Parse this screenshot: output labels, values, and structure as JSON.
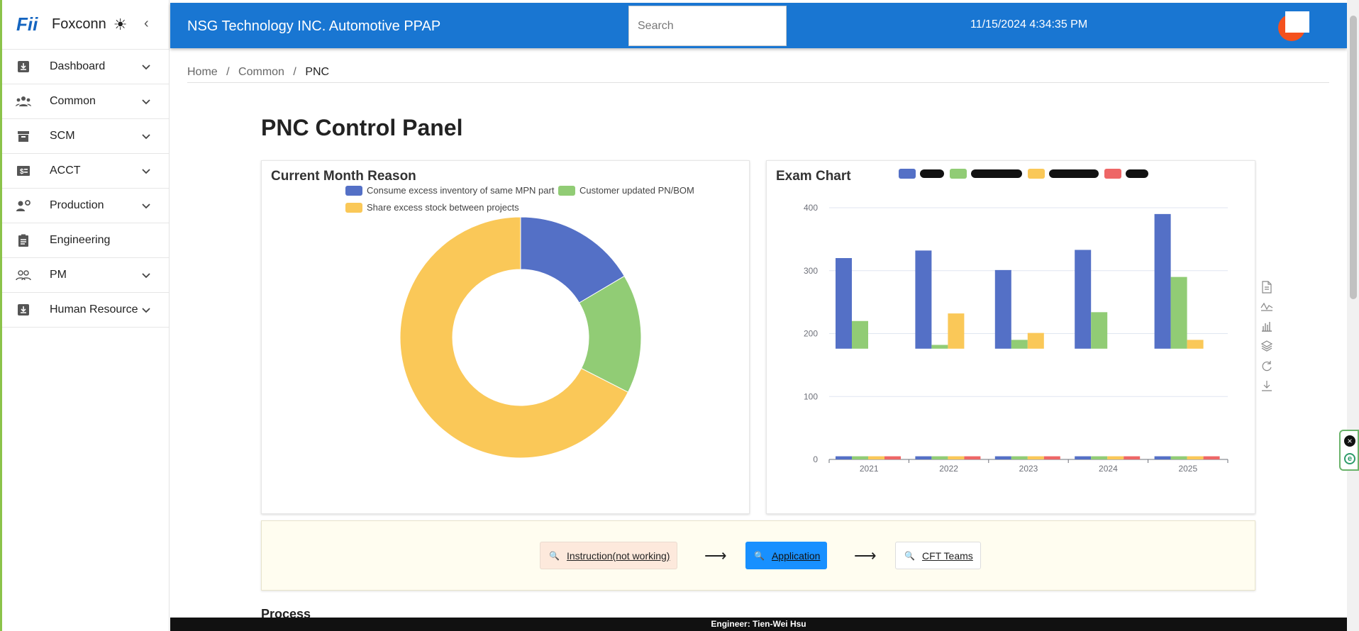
{
  "brand": {
    "logo": "Fii",
    "name": "Foxconn"
  },
  "sidebar": {
    "items": [
      {
        "label": "Dashboard",
        "icon": "download-box-icon",
        "expandable": true
      },
      {
        "label": "Common",
        "icon": "group-icon",
        "expandable": true
      },
      {
        "label": "SCM",
        "icon": "archive-icon",
        "expandable": true
      },
      {
        "label": "ACCT",
        "icon": "money-icon",
        "expandable": true
      },
      {
        "label": "Production",
        "icon": "worker-settings-icon",
        "expandable": true
      },
      {
        "label": "Engineering",
        "icon": "clipboard-icon",
        "expandable": false
      },
      {
        "label": "PM",
        "icon": "people-outline-icon",
        "expandable": true
      },
      {
        "label": "Human Resource",
        "icon": "download-box-icon",
        "expandable": true
      }
    ]
  },
  "header": {
    "title": "NSG Technology INC. Automotive PPAP",
    "search_placeholder": "Search",
    "datetime": "11/15/2024 4:34:35 PM",
    "color": "#1976d2"
  },
  "breadcrumb": [
    "Home",
    "Common",
    "PNC"
  ],
  "page": {
    "title": "PNC Control Panel"
  },
  "donut_card": {
    "title": "Current Month Reason",
    "legend": [
      "Consume excess inventory of same MPN part",
      "Customer updated PN/BOM",
      "Share excess stock between projects"
    ]
  },
  "bar_card": {
    "title": "Exam Chart"
  },
  "chart_data": [
    {
      "type": "pie",
      "title": "Current Month Reason",
      "labels": [
        "Consume excess inventory of same MPN part",
        "Customer updated PN/BOM",
        "Share excess stock between projects"
      ],
      "values": [
        16.5,
        16,
        67.5
      ],
      "colors": [
        "#5470c6",
        "#91cc75",
        "#fac858"
      ],
      "donut": true
    },
    {
      "type": "bar",
      "title": "Exam Chart",
      "categories": [
        "2021",
        "2022",
        "2023",
        "2024",
        "2025"
      ],
      "ylim": [
        0,
        400
      ],
      "yticks": [
        0,
        100,
        200,
        300,
        400
      ],
      "grid": true,
      "colors": [
        "#5470c6",
        "#91cc75",
        "#fac858",
        "#ee6666"
      ],
      "upper_panel": {
        "baseline": 176,
        "series": [
          {
            "values": [
              320,
              332,
              301,
              333,
              390
            ]
          },
          {
            "values": [
              220,
              182,
              190,
              234,
              290
            ]
          },
          {
            "values": [
              176,
              232,
              201,
              176,
              190
            ]
          },
          {
            "values": [
              176,
              176,
              176,
              176,
              176
            ]
          }
        ]
      },
      "lower_panel": {
        "series": [
          {
            "values": [
              5,
              5,
              5,
              5,
              5
            ]
          },
          {
            "values": [
              5,
              5,
              5,
              5,
              5
            ]
          },
          {
            "values": [
              5,
              5,
              5,
              5,
              5
            ]
          },
          {
            "values": [
              5,
              5,
              5,
              5,
              5
            ]
          }
        ]
      }
    }
  ],
  "toolbox": [
    "data-view-icon",
    "line-chart-icon",
    "bar-chart-icon",
    "stack-icon",
    "restore-icon",
    "download-icon"
  ],
  "flow": {
    "steps": [
      {
        "label": "Instruction(not working)",
        "bg": "#fde9dc",
        "fg": "#222"
      },
      {
        "label": "Application",
        "bg": "#1890ff",
        "fg": "#111"
      },
      {
        "label": "CFT Teams",
        "bg": "#ffffff",
        "fg": "#222"
      }
    ],
    "arrow": "⟶"
  },
  "section": {
    "process": "Process"
  },
  "footer": {
    "text": "Engineer: Tien-Wei Hsu"
  }
}
